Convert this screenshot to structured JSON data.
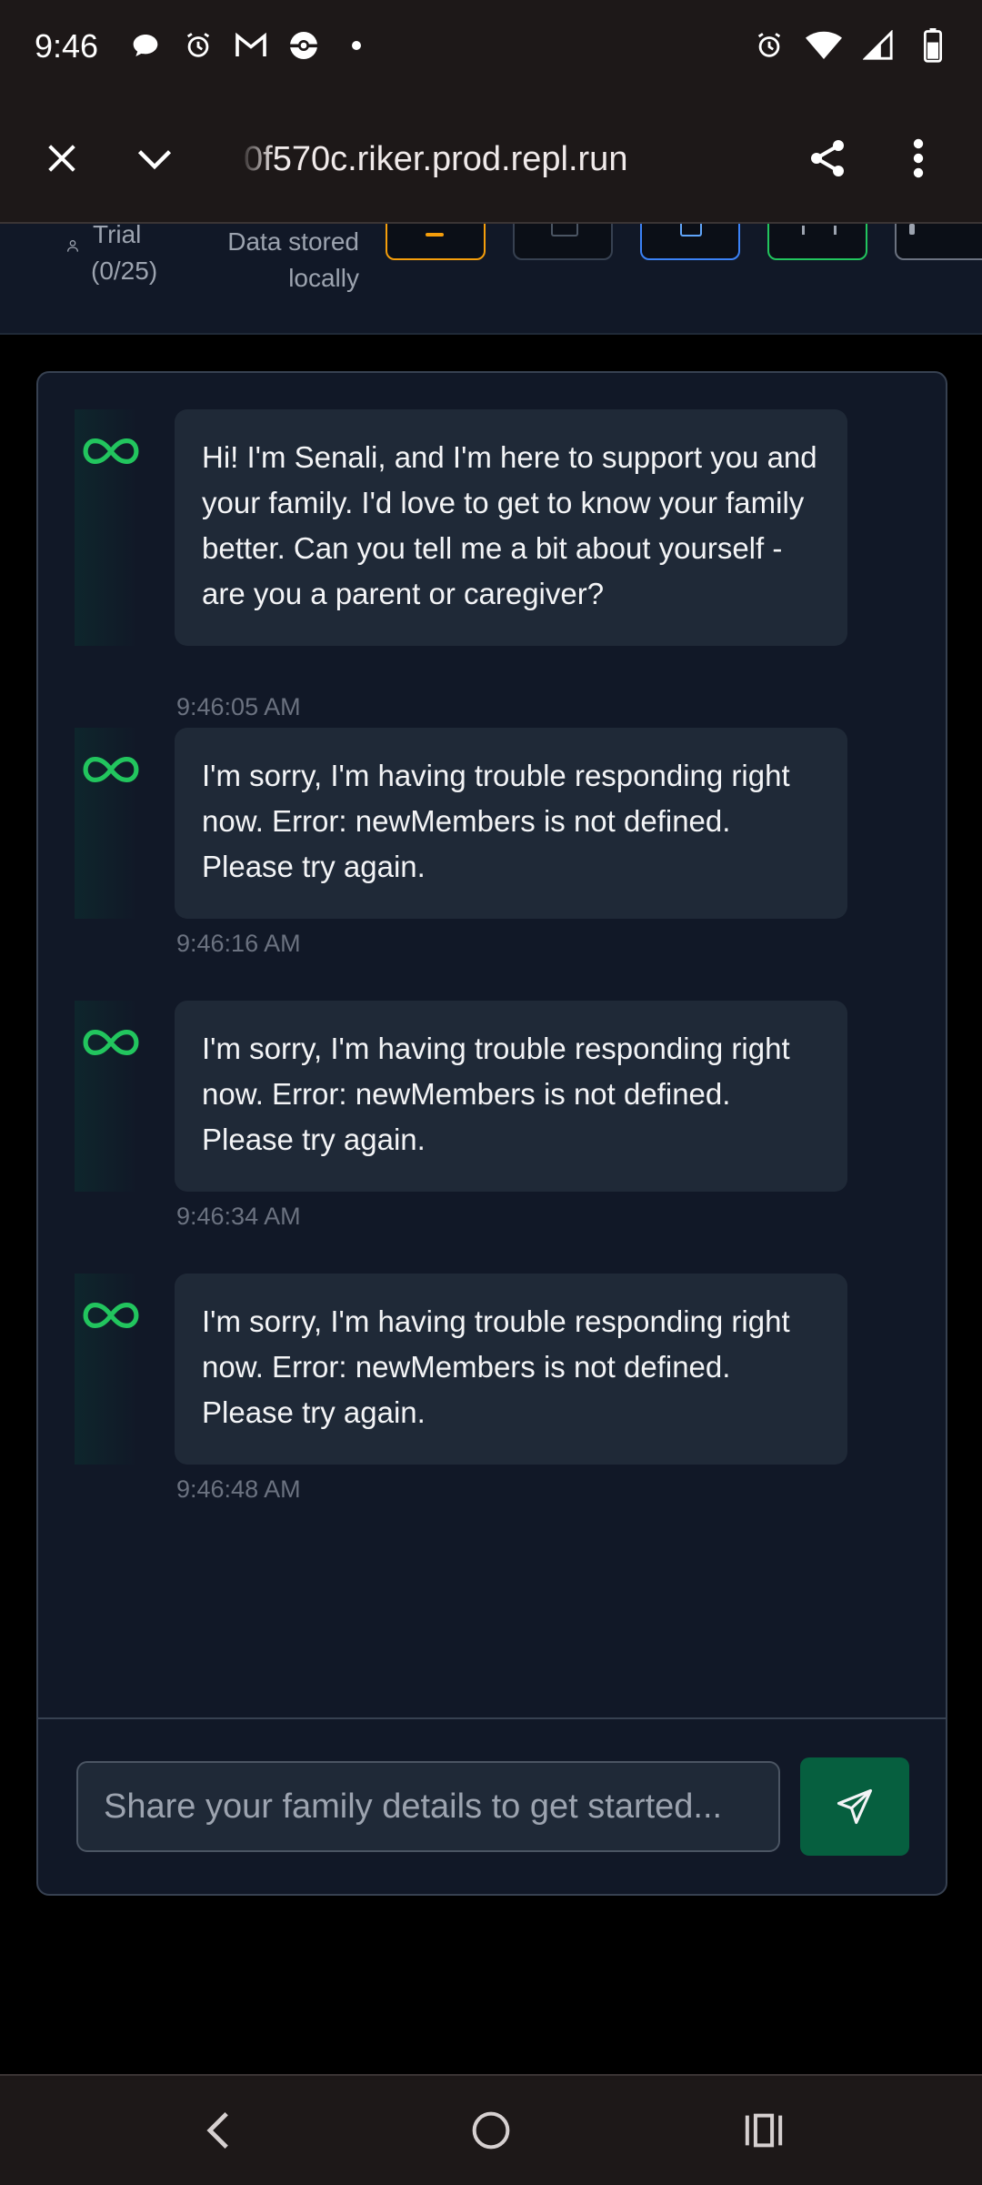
{
  "status_bar": {
    "time": "9:46",
    "left_icons": [
      "chat-bubble-icon",
      "alarm-icon",
      "gmail-icon",
      "pokeball-icon",
      "dot-icon"
    ],
    "right_icons": [
      "alarm-icon",
      "wifi-icon",
      "signal-icon",
      "battery-icon"
    ]
  },
  "browser": {
    "url": "0f570c.riker.prod.repl.run",
    "close_icon": "close-icon",
    "dropdown_icon": "chevron-down-icon",
    "share_icon": "share-icon",
    "menu_icon": "more-vert-icon"
  },
  "header": {
    "trial_line1": "Trial",
    "trial_line2": "(0/25)",
    "storage_line1": "Data stored",
    "storage_line2": "locally",
    "chip_colors": [
      "#f59e0b",
      "#374151",
      "#3b82f6",
      "#22c55e",
      "#6b7280"
    ]
  },
  "messages": [
    {
      "text": "Hi! I'm Senali, and I'm here to support you and your family. I'd love to get to know your family better. Can you tell me a bit about yourself - are you a parent or caregiver?",
      "time": "9:46:05 AM"
    },
    {
      "text": "I'm sorry, I'm having trouble responding right now. Error: newMembers is not defined. Please try again.",
      "time": "9:46:16 AM"
    },
    {
      "text": "I'm sorry, I'm having trouble responding right now. Error: newMembers is not defined. Please try again.",
      "time": "9:46:34 AM"
    },
    {
      "text": "I'm sorry, I'm having trouble responding right now. Error: newMembers is not defined. Please try again.",
      "time": "9:46:48 AM"
    }
  ],
  "composer": {
    "placeholder": "Share your family details to get started...",
    "send_icon": "send-icon"
  },
  "colors": {
    "accent_green": "#22c55e",
    "send_button": "#065f3f",
    "panel_bg": "#111827",
    "bubble_bg": "#1f2937"
  },
  "nav_bar": {
    "icons": [
      "back-icon",
      "home-icon",
      "recents-icon"
    ]
  }
}
